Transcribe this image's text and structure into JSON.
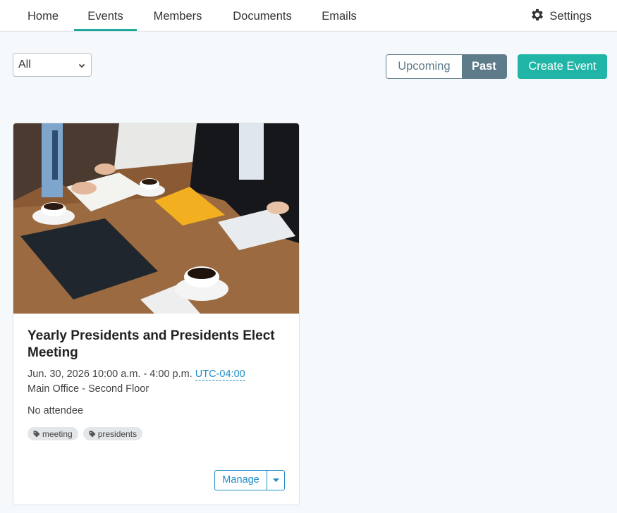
{
  "nav": {
    "tabs": [
      {
        "label": "Home"
      },
      {
        "label": "Events"
      },
      {
        "label": "Members"
      },
      {
        "label": "Documents"
      },
      {
        "label": "Emails"
      }
    ],
    "active_tab": "Events",
    "settings_label": "Settings"
  },
  "toolbar": {
    "filter_value": "All",
    "upcoming_label": "Upcoming",
    "past_label": "Past",
    "create_label": "Create Event"
  },
  "event": {
    "title": "Yearly Presidents and Presidents Elect Meeting",
    "datetime": "Jun. 30, 2026 10:00 a.m. - 4:00 p.m.",
    "timezone": "UTC-04:00",
    "location": "Main Office - Second Floor",
    "attendees": "No attendee",
    "tags": [
      "meeting",
      "presidents"
    ],
    "manage_label": "Manage"
  },
  "colors": {
    "accent": "#20b5a6",
    "slate": "#5e7b8a",
    "link": "#1f8cc7"
  }
}
